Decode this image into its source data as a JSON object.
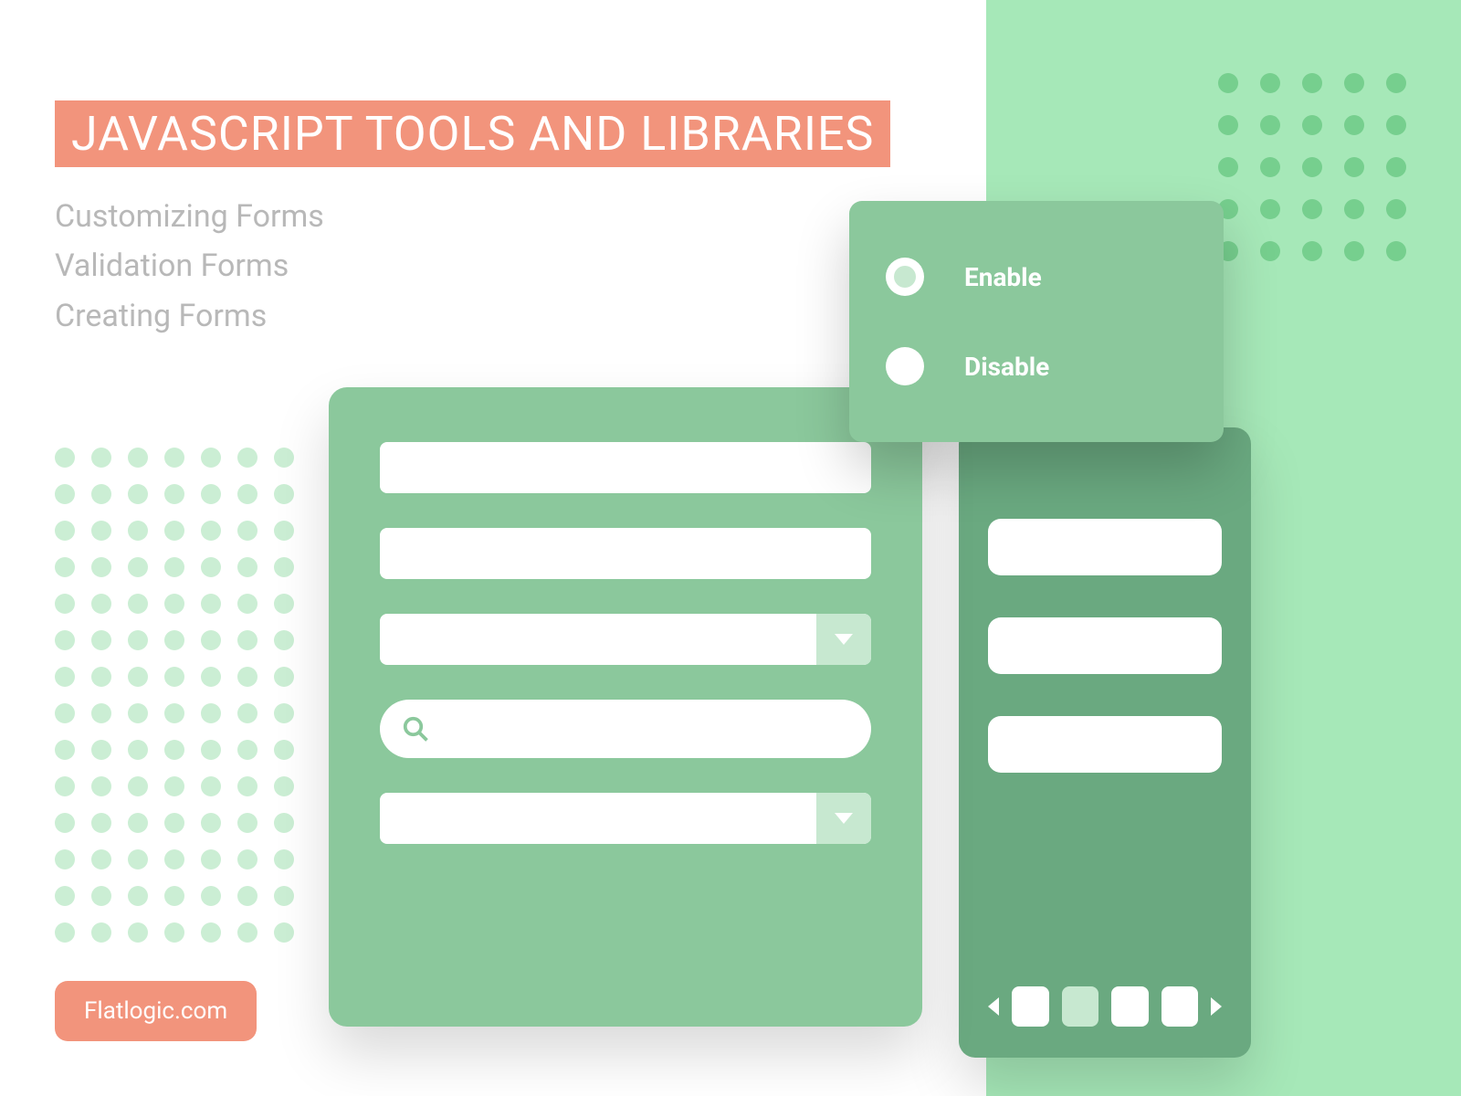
{
  "heading": "JAVASCRIPT TOOLS AND LIBRARIES",
  "subtitles": [
    "Customizing Forms",
    "Validation Forms",
    "Creating Forms"
  ],
  "brand": "Flatlogic.com",
  "radio": {
    "option1": "Enable",
    "option2": "Disable"
  },
  "colors": {
    "accent": "#f2947c",
    "greenLight": "#a6e8b8",
    "greenMid": "#8bc89c",
    "greenDark": "#6aa980"
  }
}
